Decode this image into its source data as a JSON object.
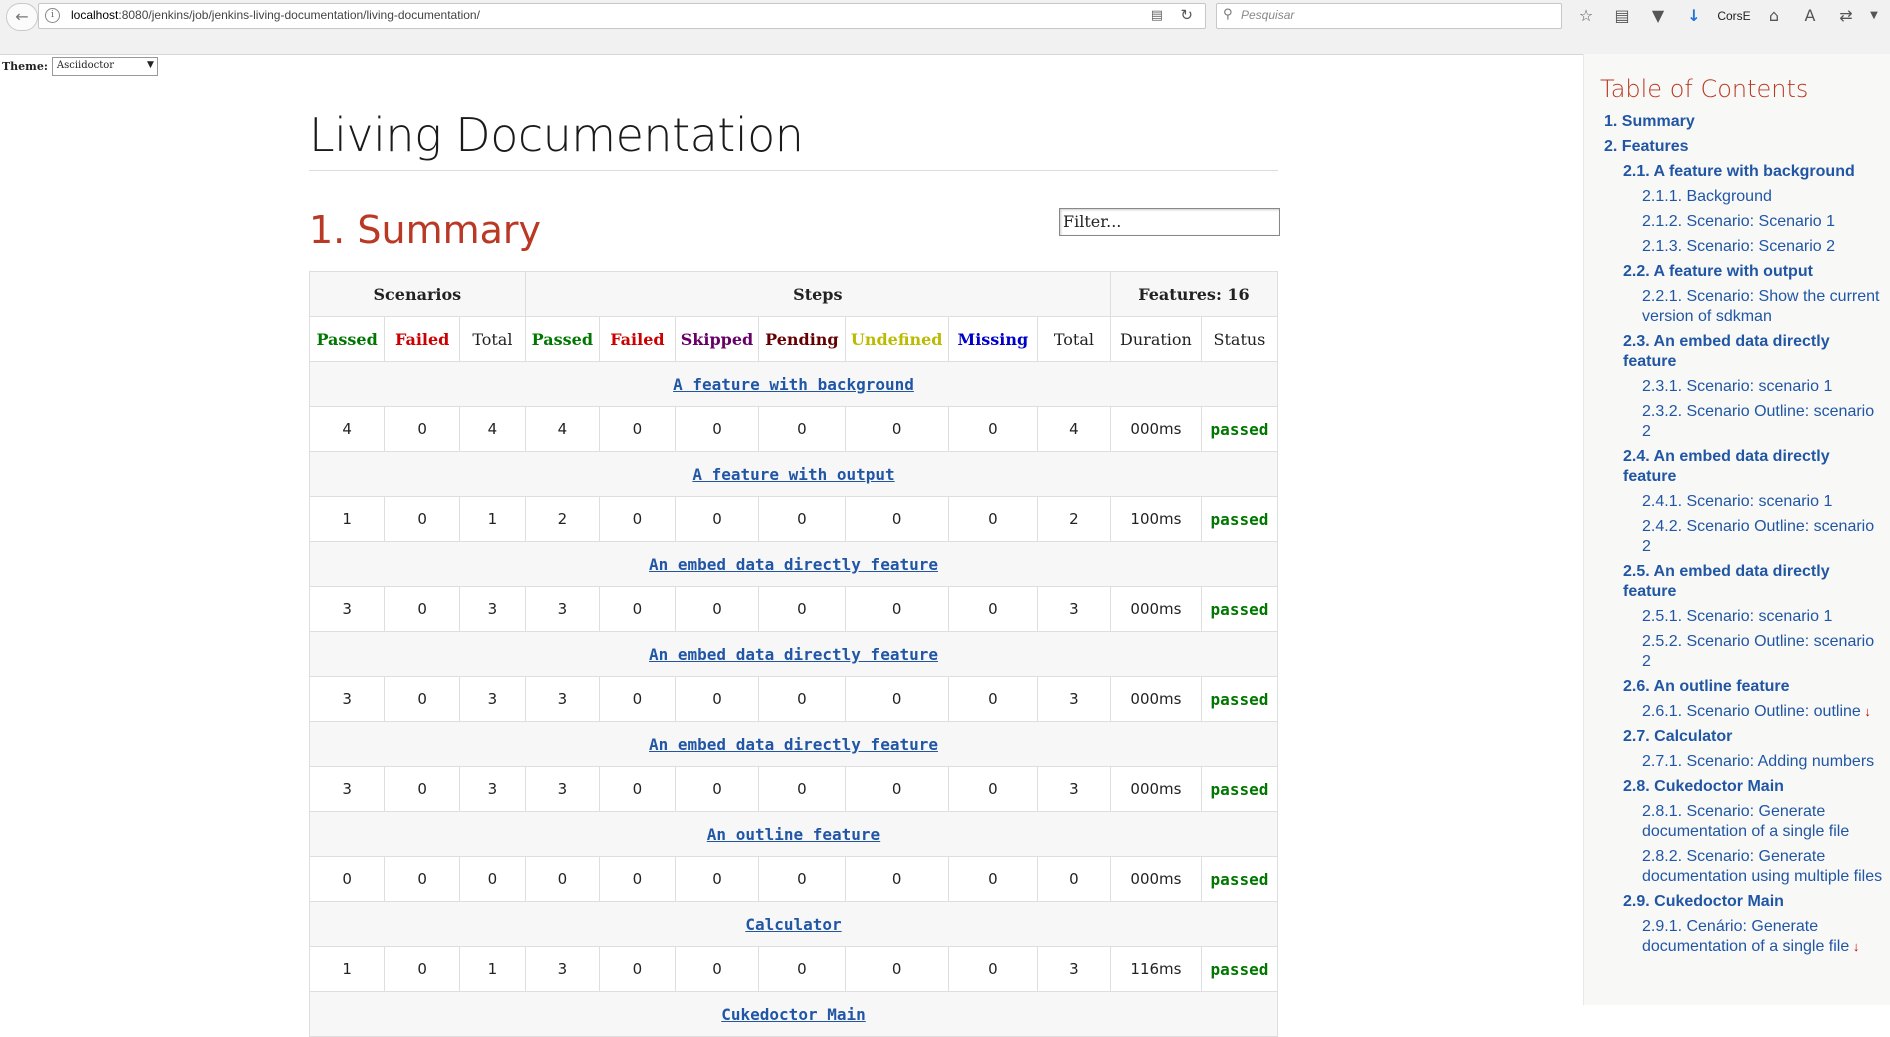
{
  "browser": {
    "url_host": "localhost",
    "url_rest": ":8080/jenkins/job/jenkins-living-documentation/living-documentation/",
    "search_placeholder": "Pesquisar",
    "user_label": "CorsE"
  },
  "theme": {
    "label": "Theme:",
    "selected": "Asciidoctor"
  },
  "doc": {
    "title": "Living Documentation",
    "section_number": "1.",
    "section_title": "Summary",
    "filter_placeholder": "Filter..."
  },
  "table": {
    "group_headers": {
      "scenarios": "Scenarios",
      "steps": "Steps",
      "features": "Features: 16"
    },
    "columns": [
      "Passed",
      "Failed",
      "Total",
      "Passed",
      "Failed",
      "Skipped",
      "Pending",
      "Undefined",
      "Missing",
      "Total",
      "Duration",
      "Status"
    ],
    "features": [
      {
        "name": "A feature with background",
        "values": [
          "4",
          "0",
          "4",
          "4",
          "0",
          "0",
          "0",
          "0",
          "0",
          "4",
          "000ms"
        ],
        "status": "passed"
      },
      {
        "name": "A feature with output",
        "values": [
          "1",
          "0",
          "1",
          "2",
          "0",
          "0",
          "0",
          "0",
          "0",
          "2",
          "100ms"
        ],
        "status": "passed"
      },
      {
        "name": "An embed data directly feature",
        "values": [
          "3",
          "0",
          "3",
          "3",
          "0",
          "0",
          "0",
          "0",
          "0",
          "3",
          "000ms"
        ],
        "status": "passed"
      },
      {
        "name": "An embed data directly feature",
        "values": [
          "3",
          "0",
          "3",
          "3",
          "0",
          "0",
          "0",
          "0",
          "0",
          "3",
          "000ms"
        ],
        "status": "passed"
      },
      {
        "name": "An embed data directly feature",
        "values": [
          "3",
          "0",
          "3",
          "3",
          "0",
          "0",
          "0",
          "0",
          "0",
          "3",
          "000ms"
        ],
        "status": "passed"
      },
      {
        "name": "An outline feature",
        "values": [
          "0",
          "0",
          "0",
          "0",
          "0",
          "0",
          "0",
          "0",
          "0",
          "0",
          "000ms"
        ],
        "status": "passed"
      },
      {
        "name": "Calculator",
        "values": [
          "1",
          "0",
          "1",
          "3",
          "0",
          "0",
          "0",
          "0",
          "0",
          "3",
          "116ms"
        ],
        "status": "passed"
      },
      {
        "name": "Cukedoctor Main",
        "values": [],
        "status": ""
      }
    ]
  },
  "toc": {
    "title": "Table of Contents",
    "items": [
      {
        "level": 1,
        "text": "1. Summary"
      },
      {
        "level": 1,
        "text": "2. Features"
      },
      {
        "level": 2,
        "text": "2.1. A feature with background"
      },
      {
        "level": 3,
        "text": "2.1.1. Background"
      },
      {
        "level": 3,
        "text": "2.1.2. Scenario: Scenario 1"
      },
      {
        "level": 3,
        "text": "2.1.3. Scenario: Scenario 2"
      },
      {
        "level": 2,
        "text": "2.2. A feature with output"
      },
      {
        "level": 3,
        "text": "2.2.1. Scenario: Show the current version of sdkman"
      },
      {
        "level": 2,
        "text": "2.3. An embed data directly feature"
      },
      {
        "level": 3,
        "text": "2.3.1. Scenario: scenario 1"
      },
      {
        "level": 3,
        "text": "2.3.2. Scenario Outline: scenario 2"
      },
      {
        "level": 2,
        "text": "2.4. An embed data directly feature"
      },
      {
        "level": 3,
        "text": "2.4.1. Scenario: scenario 1"
      },
      {
        "level": 3,
        "text": "2.4.2. Scenario Outline: scenario 2"
      },
      {
        "level": 2,
        "text": "2.5. An embed data directly feature"
      },
      {
        "level": 3,
        "text": "2.5.1. Scenario: scenario 1"
      },
      {
        "level": 3,
        "text": "2.5.2. Scenario Outline: scenario 2"
      },
      {
        "level": 2,
        "text": "2.6. An outline feature"
      },
      {
        "level": 3,
        "text": "2.6.1. Scenario Outline: outline",
        "icon": "thumbs-down-icon"
      },
      {
        "level": 2,
        "text": "2.7. Calculator"
      },
      {
        "level": 3,
        "text": "2.7.1. Scenario: Adding numbers"
      },
      {
        "level": 2,
        "text": "2.8. Cukedoctor Main"
      },
      {
        "level": 3,
        "text": "2.8.1. Scenario: Generate documentation of a single file"
      },
      {
        "level": 3,
        "text": "2.8.2. Scenario: Generate documentation using multiple files"
      },
      {
        "level": 2,
        "text": "2.9. Cukedoctor Main"
      },
      {
        "level": 3,
        "text": "2.9.1. Cenário: Generate documentation of a single file",
        "icon": "thumbs-down-icon"
      }
    ]
  },
  "colors": {
    "heading_red": "#ba3925",
    "link_blue": "#2156a5",
    "passed_green": "#007700",
    "failed_red": "#cc0000",
    "skipped_purple": "#660066",
    "pending_maroon": "#660000",
    "undefined_yellow": "#bbbb00",
    "missing_blue": "#0000cc"
  }
}
